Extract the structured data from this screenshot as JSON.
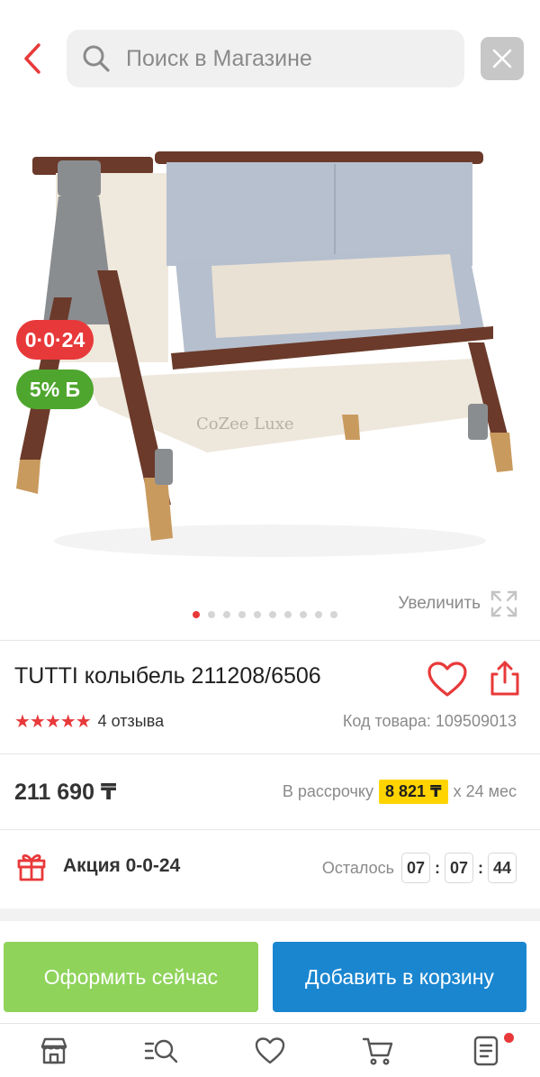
{
  "search": {
    "placeholder": "Поиск в Магазине"
  },
  "gallery": {
    "badge_installment": "0·0·24",
    "badge_bonus": "5% Б",
    "zoom_label": "Увеличить",
    "slides_count": 10,
    "active_slide": 1,
    "image_brand_mark": "CoZee Luxe"
  },
  "product": {
    "title": "TUTTI колыбель 211208/6506",
    "rating_stars": "★★★★★",
    "rating_value": 5,
    "reviews": "4 отзыва",
    "sku": "Код товара: 109509013"
  },
  "pricing": {
    "price": "211 690 ₸",
    "installment_prefix": "В рассрочку",
    "installment_amount": "8 821 ₸",
    "installment_suffix": "x 24 мес"
  },
  "promo": {
    "label": "Акция 0-0-24",
    "remaining_label": "Осталось",
    "hours": "07",
    "minutes": "07",
    "seconds": "44"
  },
  "actions": {
    "buy_now": "Оформить сейчас",
    "add_to_cart": "Добавить в корзину"
  },
  "bottom_nav": {
    "items": [
      "store-icon",
      "catalog-search-icon",
      "favorites-icon",
      "cart-icon",
      "orders-icon"
    ],
    "notification_on": "favorites-icon"
  },
  "colors": {
    "accent_red": "#e8393a",
    "bonus_green": "#4fa62e",
    "buy_green": "#8fd35b",
    "cart_blue": "#1a86d0",
    "installment_yellow": "#ffd400"
  }
}
